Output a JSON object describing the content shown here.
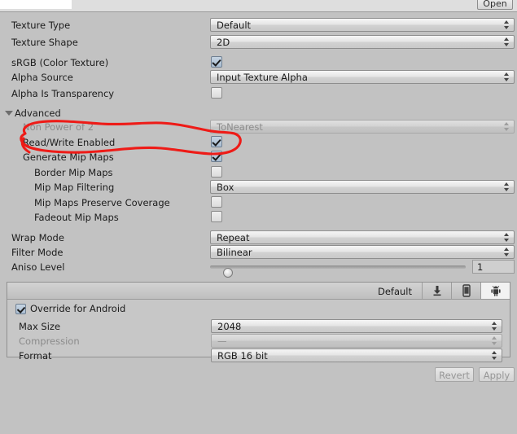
{
  "window": {
    "open_button_label": "Open",
    "background_color": "#c2c2c2"
  },
  "inspector": {
    "rows": [
      {
        "label": "Texture Type",
        "control": "dropdown",
        "value": "Default"
      },
      {
        "label": "Texture Shape",
        "control": "dropdown",
        "value": "2D"
      },
      {
        "label": "sRGB (Color Texture)",
        "control": "checkbox",
        "value": "checked"
      },
      {
        "label": "Alpha Source",
        "control": "dropdown",
        "value": "Input Texture Alpha"
      },
      {
        "label": "Alpha Is Transparency",
        "control": "checkbox",
        "value": "unchecked"
      }
    ],
    "advanced": {
      "foldout_label": "Advanced",
      "expanded": true,
      "rows": [
        {
          "label": "Non Power of 2",
          "control": "dropdown",
          "value": "ToNearest",
          "disabled": true
        },
        {
          "label": "Read/Write Enabled",
          "control": "checkbox",
          "value": "checked",
          "annotated": true
        },
        {
          "label": "Generate Mip Maps",
          "control": "checkbox",
          "value": "checked"
        },
        {
          "label": "Border Mip Maps",
          "control": "checkbox",
          "value": "unchecked",
          "indent": 2
        },
        {
          "label": "Mip Map Filtering",
          "control": "dropdown",
          "value": "Box",
          "indent": 2
        },
        {
          "label": "Mip Maps Preserve Coverage",
          "control": "checkbox",
          "value": "unchecked",
          "indent": 2
        },
        {
          "label": "Fadeout Mip Maps",
          "control": "checkbox",
          "value": "unchecked",
          "indent": 2
        }
      ]
    },
    "texture_settings": [
      {
        "label": "Wrap Mode",
        "control": "dropdown",
        "value": "Repeat"
      },
      {
        "label": "Filter Mode",
        "control": "dropdown",
        "value": "Bilinear"
      }
    ],
    "aniso": {
      "label": "Aniso Level",
      "value": "1",
      "slider_min": 0,
      "slider_max": 16,
      "slider_position_percent": 5
    }
  },
  "platform": {
    "default_tab_label": "Default",
    "tabs": [
      {
        "name": "download-icon",
        "selected": false
      },
      {
        "name": "iphone-icon",
        "selected": false
      },
      {
        "name": "android-icon",
        "selected": true
      }
    ],
    "override_label": "Override for Android",
    "override_checked": true,
    "rows": [
      {
        "label": "Max Size",
        "value": "2048",
        "disabled": false
      },
      {
        "label": "Compression",
        "value": "—",
        "disabled": true
      },
      {
        "label": "Format",
        "value": "RGB 16 bit",
        "disabled": false
      }
    ]
  },
  "footer": {
    "revert_label": "Revert",
    "apply_label": "Apply",
    "buttons_disabled": true
  },
  "annotation": {
    "type": "hand-drawn-ellipse",
    "color": "#ee1b17",
    "target": "Read/Write Enabled"
  }
}
